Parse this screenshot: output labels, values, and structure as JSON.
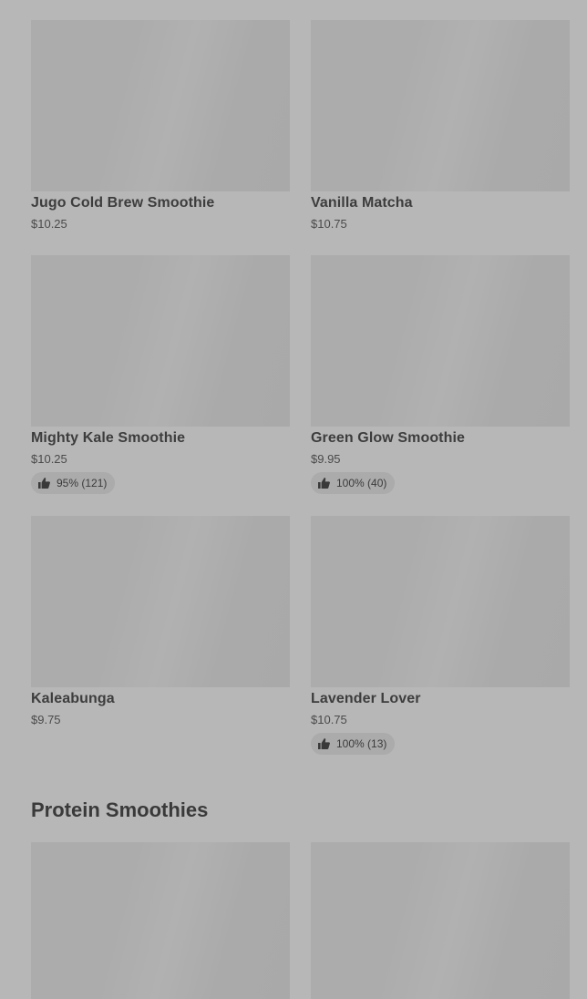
{
  "sections": [
    {
      "items": [
        {
          "name": "Jugo Cold Brew Smoothie",
          "price": "$10.25"
        },
        {
          "name": "Vanilla Matcha",
          "price": "$10.75"
        },
        {
          "name": "Mighty Kale Smoothie",
          "price": "$10.25",
          "rating": "95% (121)"
        },
        {
          "name": "Green Glow Smoothie",
          "price": "$9.95",
          "rating": "100% (40)"
        },
        {
          "name": "Kaleabunga",
          "price": "$9.75"
        },
        {
          "name": "Lavender Lover",
          "price": "$10.75",
          "rating": "100% (13)"
        }
      ]
    },
    {
      "title": "Protein Smoothies"
    }
  ],
  "icons": {
    "rating": "thumbs-up-icon"
  }
}
